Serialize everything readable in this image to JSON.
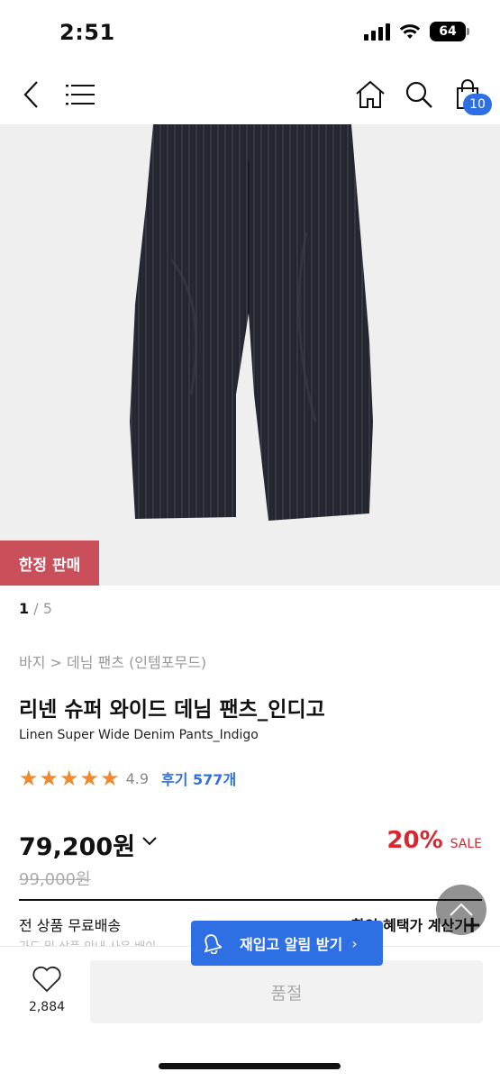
{
  "status": {
    "time": "2:51",
    "battery": "64"
  },
  "nav": {
    "cart_count": "10"
  },
  "product": {
    "badge": "한정 판매",
    "pager_current": "1",
    "pager_total": " / 5",
    "breadcrumb": "바지 > 데님 팬츠 (인템포무드)",
    "title_ko": "리넨 슈퍼 와이드 데님 팬츠_인디고",
    "title_en": "Linen Super Wide Denim Pants_Indigo",
    "rating_value": "4.9",
    "rating_stars": 5,
    "review_label": "후기 577개",
    "price": "79,200원",
    "discount_pct": "20%",
    "discount_label": "SALE",
    "original_price": "99,000원"
  },
  "shipping": {
    "label": "전 상품 무료배송",
    "sub_label": "가드 및 상품 안내 사은 배이",
    "right_label": "할인 혜택가 계산기"
  },
  "restock": {
    "label": "재입고 알림 받기",
    "chevron": "›"
  },
  "bottom": {
    "like_count": "2,884",
    "soldout_label": "품절"
  },
  "colors": {
    "accent_blue": "#2f6fe4",
    "sale_red": "#d9262f",
    "badge_red": "#c94f5a",
    "star_orange": "#f08a30"
  }
}
